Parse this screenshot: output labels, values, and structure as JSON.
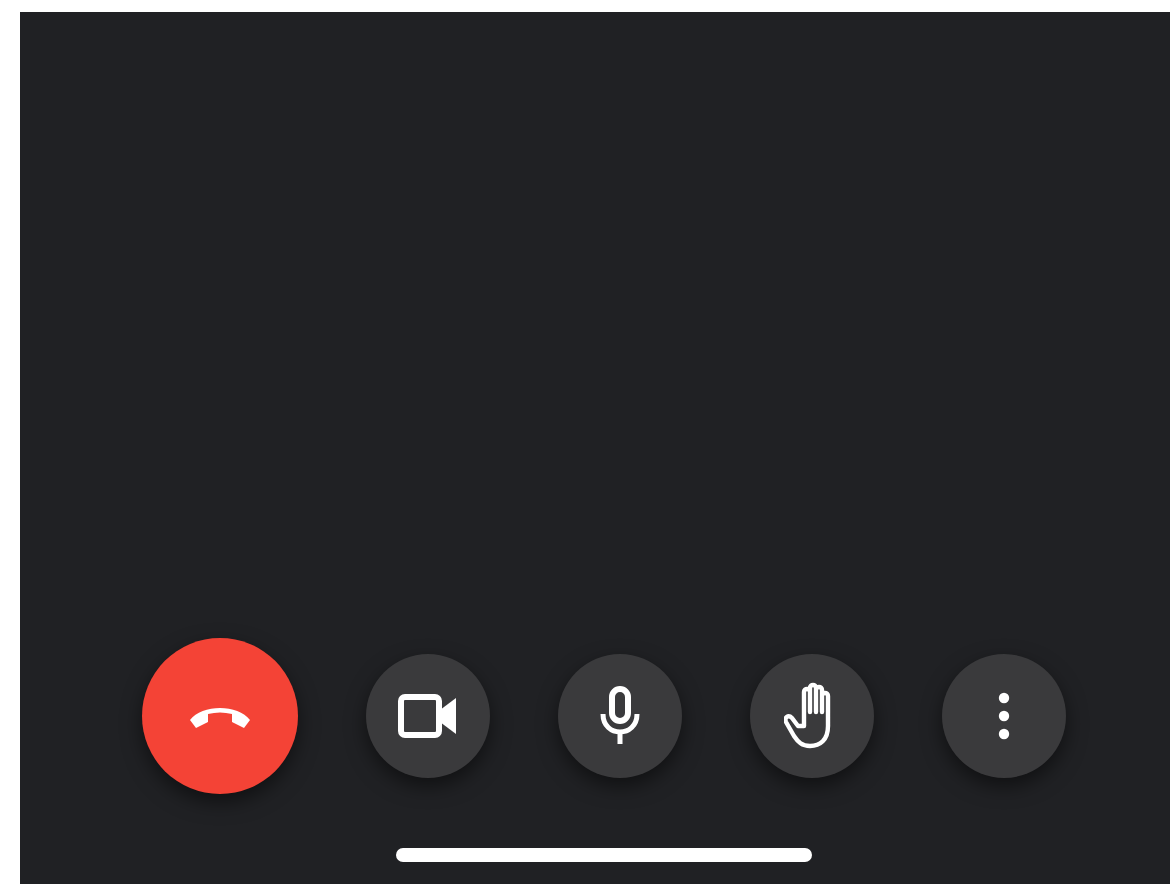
{
  "call_controls": [
    {
      "kind": "end-call"
    },
    {
      "kind": "camera"
    },
    {
      "kind": "microphone"
    },
    {
      "kind": "raise-hand"
    },
    {
      "kind": "more"
    }
  ]
}
